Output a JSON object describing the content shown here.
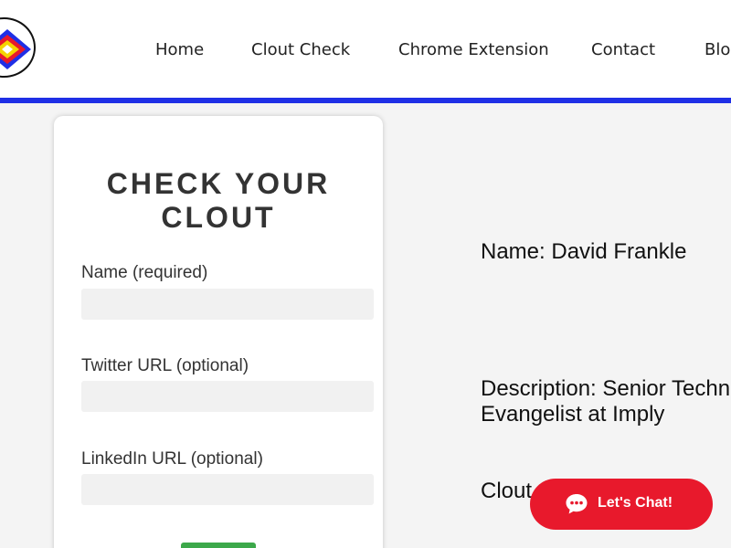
{
  "nav": {
    "items": [
      {
        "label": "Home"
      },
      {
        "label": "Clout Check"
      },
      {
        "label": "Chrome Extension"
      },
      {
        "label": "Contact"
      },
      {
        "label": "Blog"
      }
    ]
  },
  "form": {
    "title": "CHECK YOUR CLOUT",
    "name_label": "Name (required)",
    "name_value": "",
    "twitter_label": "Twitter URL (optional)",
    "twitter_value": "",
    "linkedin_label": "LinkedIn URL (optional)",
    "linkedin_value": ""
  },
  "result": {
    "name": "Name: David Frankle",
    "description_line1": "Description: Senior Technical",
    "description_line2": "Evangelist at Imply",
    "clout": "Clout"
  },
  "chat": {
    "label": "Let's Chat!"
  },
  "colors": {
    "header_bar": "#1f2fe6",
    "submit": "#3ca84a",
    "chat": "#e8192c"
  },
  "icons": {
    "logo": "layered-diamond-logo",
    "chat": "chat-bubble-icon"
  }
}
